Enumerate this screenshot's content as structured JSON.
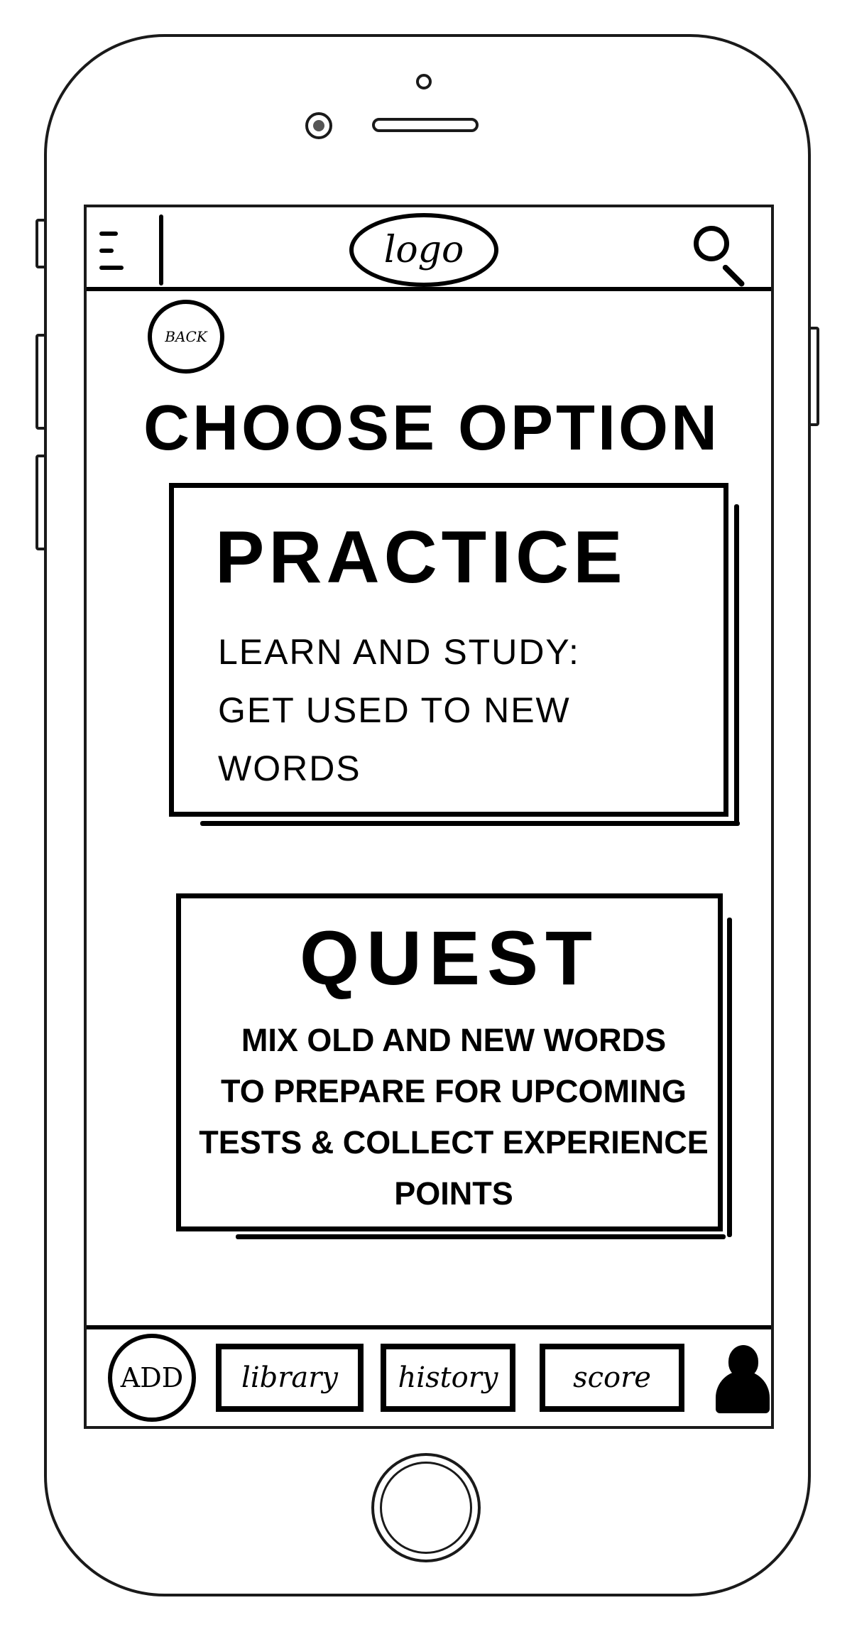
{
  "header": {
    "menu_icon": "hamburger-menu-icon",
    "logo_text": "logo",
    "search_icon": "search-icon"
  },
  "back_button": {
    "label": "BACK"
  },
  "page_title": "CHOOSE OPTION",
  "options": [
    {
      "title": "PRACTICE",
      "lines": [
        "LEARN AND STUDY:",
        "GET USED TO NEW WORDS"
      ]
    },
    {
      "title": "QUEST",
      "lines": [
        "MIX OLD AND NEW WORDS",
        "TO PREPARE FOR UPCOMING",
        "TESTS & COLLECT EXPERIENCE",
        "POINTS"
      ]
    }
  ],
  "bottom_bar": {
    "add_label": "ADD",
    "tabs": [
      {
        "label": "library"
      },
      {
        "label": "history"
      },
      {
        "label": "score"
      }
    ],
    "profile_icon": "user-profile-icon"
  },
  "colors": {
    "ink": "#000000",
    "paper": "#ffffff"
  }
}
